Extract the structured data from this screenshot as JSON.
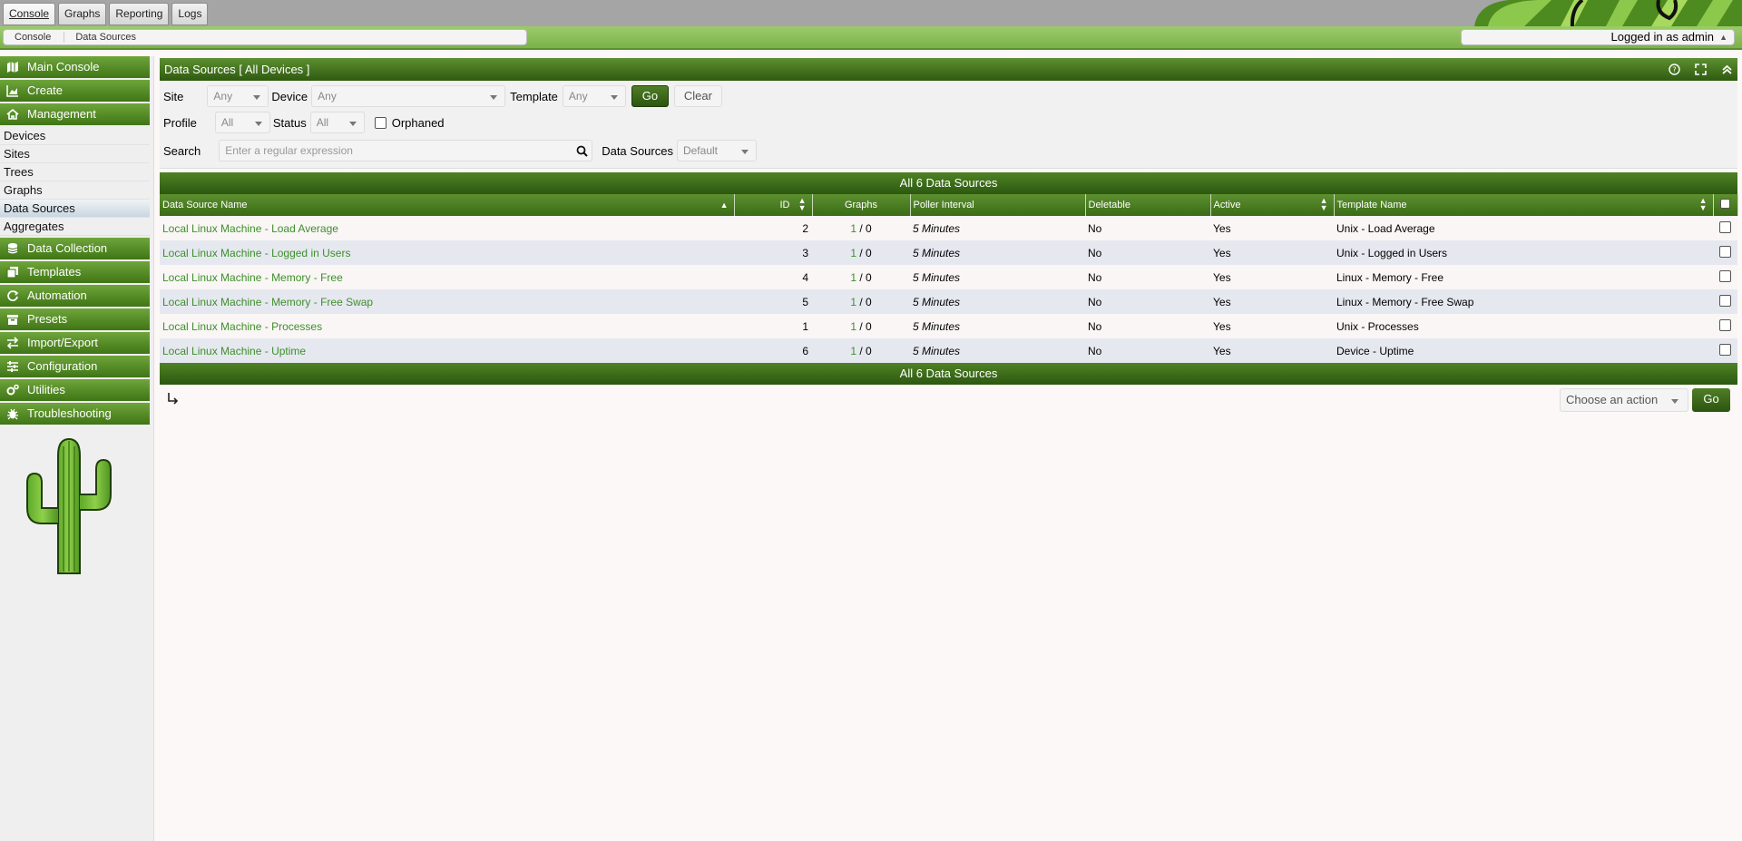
{
  "tabs": [
    "Console",
    "Graphs",
    "Reporting",
    "Logs"
  ],
  "breadcrumb": [
    "Console",
    "Data Sources"
  ],
  "user": {
    "label": "Logged in as admin"
  },
  "sidebar": {
    "items": [
      {
        "label": "Main Console",
        "icon": "map-icon"
      },
      {
        "label": "Create",
        "icon": "chart-area-icon"
      },
      {
        "label": "Management",
        "icon": "home-icon"
      }
    ],
    "management_sub": [
      "Devices",
      "Sites",
      "Trees",
      "Graphs",
      "Data Sources",
      "Aggregates"
    ],
    "items2": [
      {
        "label": "Data Collection",
        "icon": "database-icon"
      },
      {
        "label": "Templates",
        "icon": "clone-icon"
      },
      {
        "label": "Automation",
        "icon": "sync-icon"
      },
      {
        "label": "Presets",
        "icon": "archive-icon"
      },
      {
        "label": "Import/Export",
        "icon": "exchange-icon"
      },
      {
        "label": "Configuration",
        "icon": "sliders-icon"
      },
      {
        "label": "Utilities",
        "icon": "cogs-icon"
      },
      {
        "label": "Troubleshooting",
        "icon": "bug-icon"
      }
    ]
  },
  "panel": {
    "title": "Data Sources [ All Devices ]"
  },
  "filters": {
    "site_label": "Site",
    "site_value": "Any",
    "device_label": "Device",
    "device_value": "Any",
    "template_label": "Template",
    "template_value": "Any",
    "go_label": "Go",
    "clear_label": "Clear",
    "profile_label": "Profile",
    "profile_value": "All",
    "status_label": "Status",
    "status_value": "All",
    "orphaned_label": "Orphaned",
    "search_label": "Search",
    "search_placeholder": "Enter a regular expression",
    "ds_label": "Data Sources",
    "ds_value": "Default"
  },
  "summary": "All 6 Data Sources",
  "table": {
    "headers": [
      "Data Source Name",
      "ID",
      "Graphs",
      "Poller Interval",
      "Deletable",
      "Active",
      "Template Name"
    ],
    "rows": [
      {
        "name": "Local Linux Machine - Load Average",
        "id": "2",
        "graphs_a": "1",
        "graphs_b": " / 0",
        "interval": "5 Minutes",
        "deletable": "No",
        "active": "Yes",
        "template": "Unix - Load Average"
      },
      {
        "name": "Local Linux Machine - Logged in Users",
        "id": "3",
        "graphs_a": "1",
        "graphs_b": " / 0",
        "interval": "5 Minutes",
        "deletable": "No",
        "active": "Yes",
        "template": "Unix - Logged in Users"
      },
      {
        "name": "Local Linux Machine - Memory - Free",
        "id": "4",
        "graphs_a": "1",
        "graphs_b": " / 0",
        "interval": "5 Minutes",
        "deletable": "No",
        "active": "Yes",
        "template": "Linux - Memory - Free"
      },
      {
        "name": "Local Linux Machine - Memory - Free Swap",
        "id": "5",
        "graphs_a": "1",
        "graphs_b": " / 0",
        "interval": "5 Minutes",
        "deletable": "No",
        "active": "Yes",
        "template": "Linux - Memory - Free Swap"
      },
      {
        "name": "Local Linux Machine - Processes",
        "id": "1",
        "graphs_a": "1",
        "graphs_b": " / 0",
        "interval": "5 Minutes",
        "deletable": "No",
        "active": "Yes",
        "template": "Unix - Processes"
      },
      {
        "name": "Local Linux Machine - Uptime",
        "id": "6",
        "graphs_a": "1",
        "graphs_b": " / 0",
        "interval": "5 Minutes",
        "deletable": "No",
        "active": "Yes",
        "template": "Device - Uptime"
      }
    ]
  },
  "actions": {
    "placeholder": "Choose an action",
    "go_label": "Go"
  },
  "colors": {
    "brand_green": "#3f7515",
    "link_green": "#3e8f2a",
    "row_alt": "#e6e8f0"
  }
}
